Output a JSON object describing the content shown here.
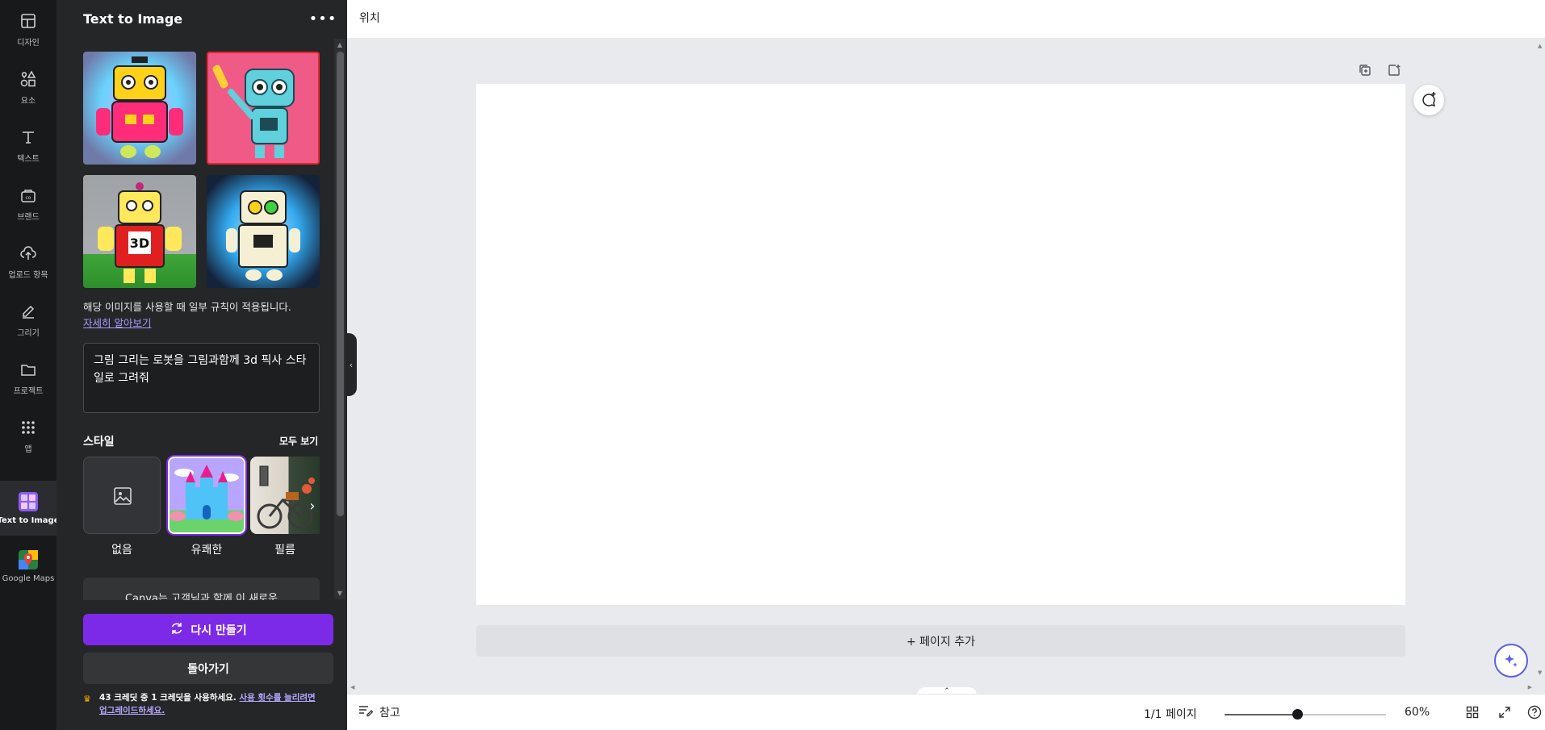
{
  "rail": {
    "items": [
      {
        "label": "디자인",
        "icon": "design-icon"
      },
      {
        "label": "요소",
        "icon": "elements-icon"
      },
      {
        "label": "텍스트",
        "icon": "text-icon"
      },
      {
        "label": "브랜드",
        "icon": "brand-icon"
      },
      {
        "label": "업로드 항목",
        "icon": "upload-icon"
      },
      {
        "label": "그리기",
        "icon": "draw-icon"
      },
      {
        "label": "프로젝트",
        "icon": "folder-icon"
      },
      {
        "label": "앱",
        "icon": "apps-icon"
      },
      {
        "label": "Text to Image",
        "icon": "text-to-image-icon",
        "active": true
      },
      {
        "label": "Google Maps",
        "icon": "google-maps-icon"
      }
    ]
  },
  "panel": {
    "title": "Text to Image",
    "more_glyph": "•••",
    "rules_text": "해당 이미지를 사용할 때 일부 규칙이 적용됩니다.",
    "learn_more": "자세히 알아보기",
    "prompt": "그림 그리는 로봇을 그림과함께 3d 픽사 스타일로 그려줘",
    "style_heading": "스타일",
    "see_all": "모두 보기",
    "styles": [
      {
        "label": "없음"
      },
      {
        "label": "유쾌한",
        "selected": true
      },
      {
        "label": "필름"
      }
    ],
    "promo_text": "Canva는 고객님과 함께 이 새로운",
    "regenerate": "다시 만들기",
    "back": "돌아가기",
    "credit_text": "43 크레딧 중 1 크레딧을 사용하세요.",
    "credit_link": "사용 횟수를 늘리려면 업그레이드하세요.",
    "thumb_label": "3D"
  },
  "topbar": {
    "position": "위치"
  },
  "canvas": {
    "add_page": "+ 페이지 추가"
  },
  "bottombar": {
    "notes": "참고",
    "pages": "1/1 페이지",
    "zoom": "60%",
    "zoom_level": 0.45
  },
  "colors": {
    "accent": "#7d2ae8",
    "panel_bg": "#252627",
    "rail_bg": "#18191b",
    "link": "#a99cff",
    "selected_outline": "#e62631"
  }
}
